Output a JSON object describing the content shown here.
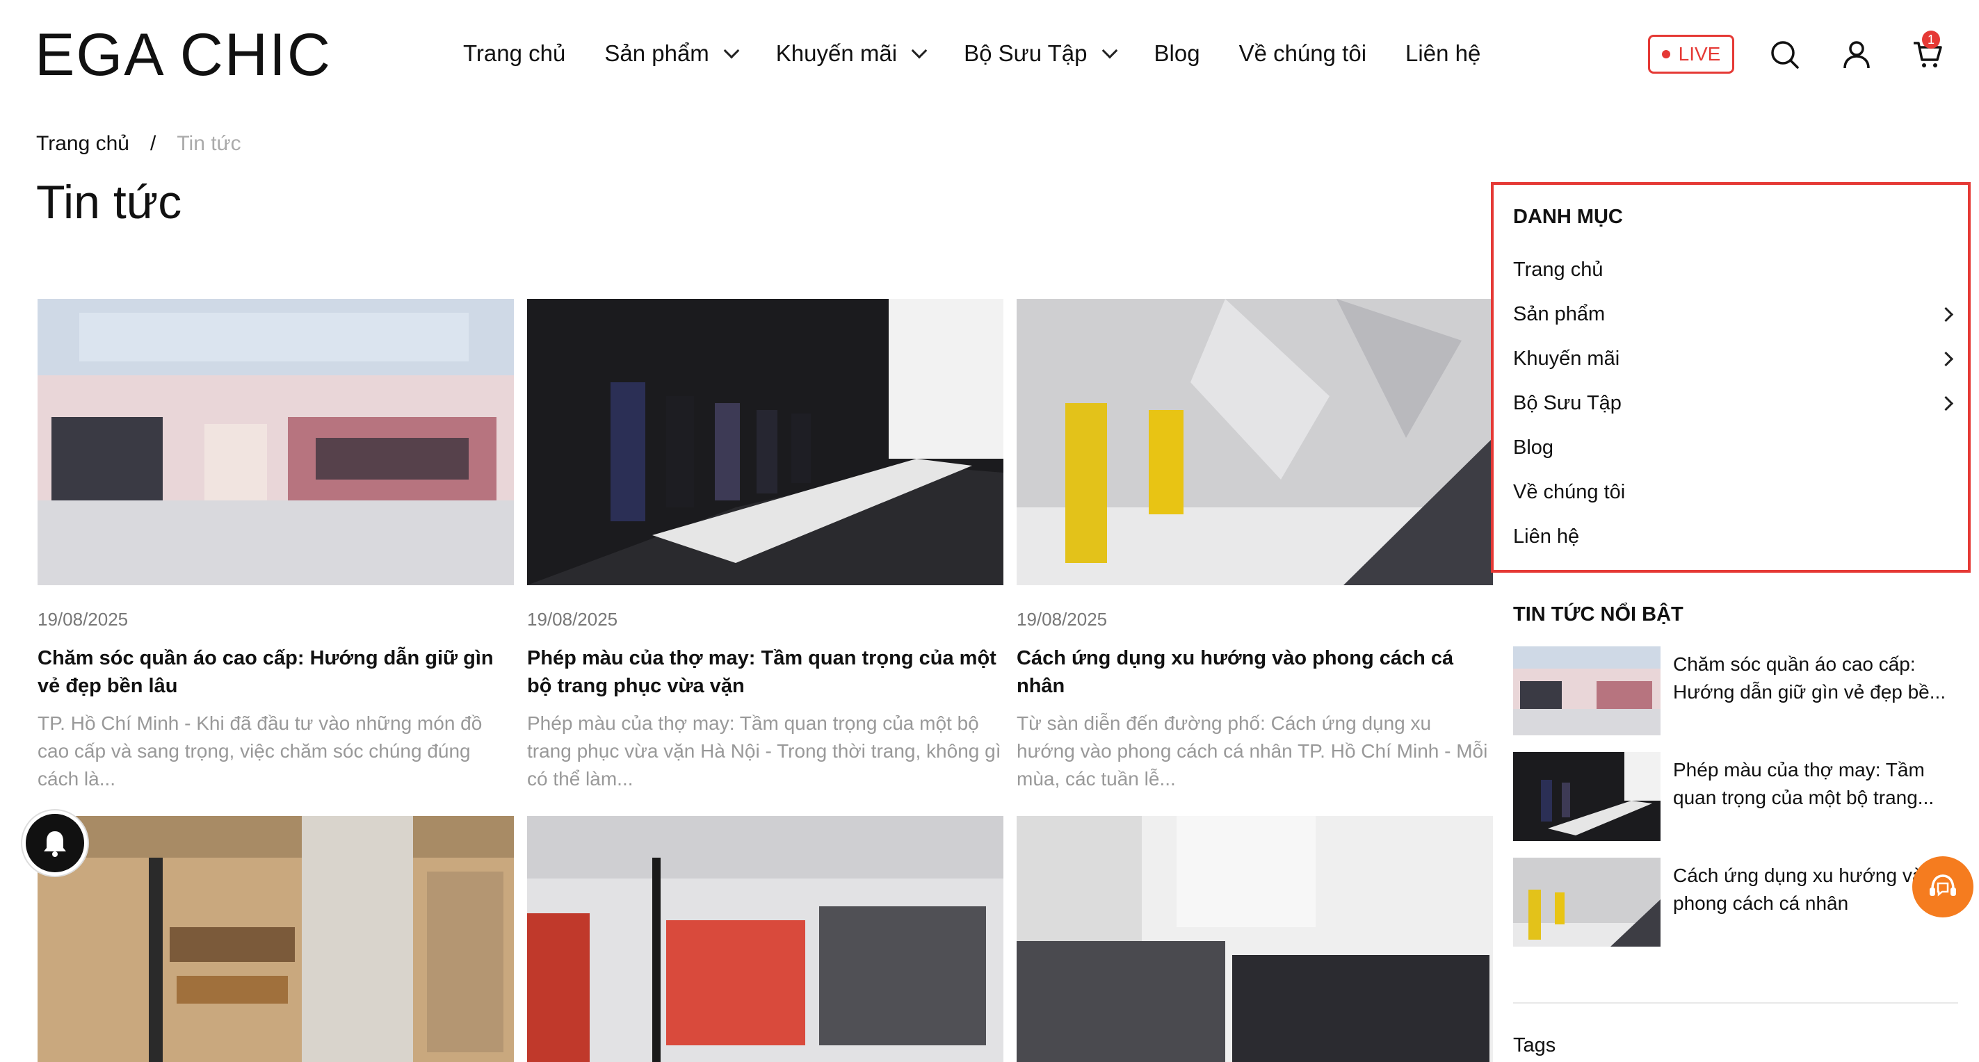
{
  "header": {
    "logo": "EGA CHIC",
    "nav": [
      {
        "label": "Trang chủ",
        "has_dropdown": false
      },
      {
        "label": "Sản phẩm",
        "has_dropdown": true
      },
      {
        "label": "Khuyến mãi",
        "has_dropdown": true
      },
      {
        "label": "Bộ Sưu Tập",
        "has_dropdown": true
      },
      {
        "label": "Blog",
        "has_dropdown": false
      },
      {
        "label": "Về chúng tôi",
        "has_dropdown": false
      },
      {
        "label": "Liên hệ",
        "has_dropdown": false
      }
    ],
    "live_label": "LIVE",
    "cart_count": "1",
    "icons": [
      "search-icon",
      "user-icon",
      "cart-icon"
    ]
  },
  "breadcrumb": {
    "home": "Trang chủ",
    "separator": "/",
    "current": "Tin tức"
  },
  "page_title": "Tin tức",
  "articles": [
    {
      "date": "19/08/2025",
      "title": "Chăm sóc quần áo cao cấp: Hướng dẫn giữ gìn vẻ đẹp bền lâu",
      "excerpt": "TP. Hồ Chí Minh - Khi đã đầu tư vào những món đồ cao cấp và sang trọng, việc chăm sóc chúng đúng cách là..."
    },
    {
      "date": "19/08/2025",
      "title": "Phép màu của thợ may: Tầm quan trọng của một bộ trang phục vừa vặn",
      "excerpt": "Phép màu của thợ may: Tầm quan trọng của một bộ trang phục vừa vặn   Hà Nội - Trong thời trang, không gì có thể làm..."
    },
    {
      "date": "19/08/2025",
      "title": "Cách ứng dụng xu hướng vào phong cách cá nhân",
      "excerpt": "Từ sàn diễn đến đường phố: Cách ứng dụng xu hướng vào phong cách cá nhân   TP. Hồ Chí Minh - Mỗi mùa, các tuần lễ..."
    }
  ],
  "sidebar": {
    "category_heading": "DANH MỤC",
    "categories": [
      {
        "label": "Trang chủ",
        "has_children": false
      },
      {
        "label": "Sản phẩm",
        "has_children": true
      },
      {
        "label": "Khuyến mãi",
        "has_children": true
      },
      {
        "label": "Bộ Sưu Tập",
        "has_children": true
      },
      {
        "label": "Blog",
        "has_children": false
      },
      {
        "label": "Về chúng tôi",
        "has_children": false
      },
      {
        "label": "Liên hệ",
        "has_children": false
      }
    ],
    "featured_heading": "TIN TỨC NỔI BẬT",
    "featured": [
      {
        "title": "Chăm sóc quần áo cao cấp: Hướng dẫn giữ gìn vẻ đẹp bề..."
      },
      {
        "title": "Phép màu của thợ may: Tầm quan trọng của một bộ trang..."
      },
      {
        "title": "Cách ứng dụng xu hướng vào phong cách cá nhân"
      }
    ],
    "tags_heading": "Tags"
  },
  "colors": {
    "accent": "#e53935",
    "support": "#f57c1f",
    "muted": "#999999"
  }
}
